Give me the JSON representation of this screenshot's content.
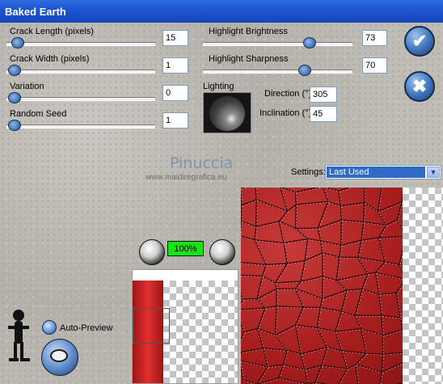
{
  "window": {
    "title": "Baked Earth"
  },
  "sliders": [
    {
      "label": "Crack Length (pixels)",
      "value": "15",
      "level": 0.04
    },
    {
      "label": "Crack Width (pixels)",
      "value": "1",
      "level": 0.0
    },
    {
      "label": "Variation",
      "value": "0",
      "level": 0.0
    },
    {
      "label": "Random Seed",
      "value": "1",
      "level": 0.0
    },
    {
      "label": "Highlight Brightness",
      "value": "73",
      "level": 0.73
    },
    {
      "label": "Highlight Sharpness",
      "value": "70",
      "level": 0.7
    }
  ],
  "lighting": {
    "label": "Lighting",
    "direction_label": "Direction (°)",
    "direction_value": "305",
    "inclination_label": "Inclination (°)",
    "inclination_value": "45"
  },
  "watermark": {
    "name": "Pinuccia",
    "site": "www.maidiregrafica.eu"
  },
  "settings": {
    "label": "Settings:",
    "selected": "Last Used"
  },
  "zoom": {
    "value": "100%"
  },
  "preview": {
    "auto_preview_label": "Auto-Preview"
  },
  "icons": {
    "ok": "ok-check-icon",
    "cancel": "cancel-x-icon",
    "zoom_out": "zoom-out-eye-icon",
    "zoom_in": "zoom-in-eye-icon",
    "help": "help-figure-icon",
    "preview_eye": "preview-eye-icon"
  }
}
